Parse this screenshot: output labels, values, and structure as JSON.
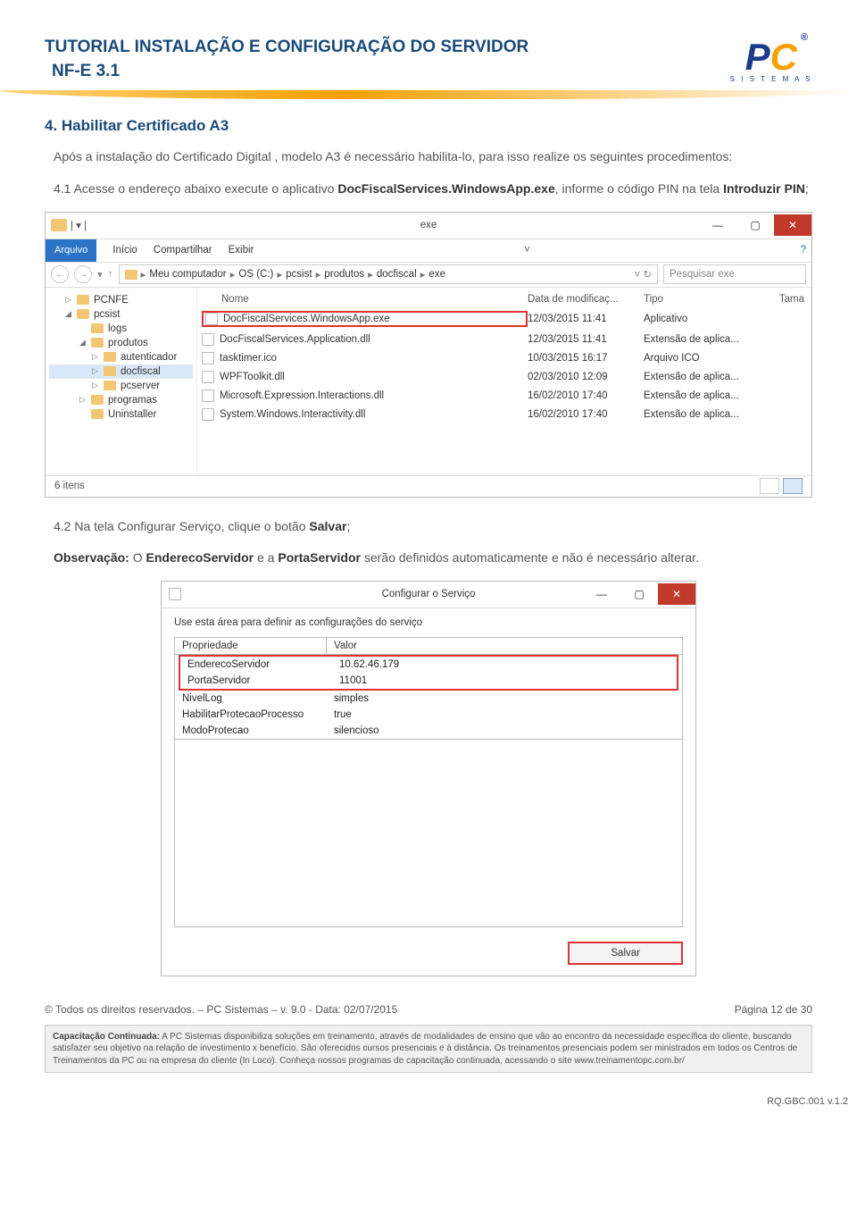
{
  "header": {
    "title_l1": "TUTORIAL INSTALAÇÃO E CONFIGURAÇÃO DO SERVIDOR",
    "title_l2": "NF-E 3.1",
    "logo_sub": "S I S T E M A S",
    "logo_r": "®",
    "logo_p": "P",
    "logo_c": "C"
  },
  "section": {
    "heading": "4. Habilitar Certificado A3",
    "intro": "Após a instalação do Certificado Digital , modelo A3 é necessário habilita-lo, para isso realize os seguintes procedimentos:",
    "step41_a": "4.1 Acesse o endereço abaixo  execute o aplicativo ",
    "step41_file": "DocFiscalServices.WindowsApp.exe",
    "step41_b": ", informe o código PIN na tela ",
    "step41_tela": "Introduzir PIN",
    "step41_c": ";",
    "step42_a": "4.2 Na tela Configurar Serviço, clique o botão ",
    "step42_btn": "Salvar",
    "step42_b": ";",
    "obs_a": "Observação:",
    "obs_b": " O ",
    "obs_c": "EnderecoServidor",
    "obs_d": " e a ",
    "obs_e": "PortaServidor",
    "obs_f": " serão definidos automaticamente e não é necessário alterar."
  },
  "explorer": {
    "title_center": "exe",
    "ribbon": {
      "arquivo": "Arquivo",
      "inicio": "Início",
      "compartilhar": "Compartilhar",
      "exibir": "Exibir",
      "help": "?"
    },
    "breadcrumb": [
      "Meu computador",
      "OS (C:)",
      "pcsist",
      "produtos",
      "docfiscal",
      "exe"
    ],
    "search_placeholder": "Pesquisar exe",
    "tree": [
      {
        "label": "PCNFE",
        "indent": 1,
        "exp": "▷"
      },
      {
        "label": "pcsist",
        "indent": 1,
        "exp": "◢"
      },
      {
        "label": "logs",
        "indent": 2,
        "exp": ""
      },
      {
        "label": "produtos",
        "indent": 2,
        "exp": "◢"
      },
      {
        "label": "autenticador",
        "indent": 3,
        "exp": "▷"
      },
      {
        "label": "docfiscal",
        "indent": 3,
        "exp": "▷",
        "sel": true
      },
      {
        "label": "pcserver",
        "indent": 3,
        "exp": "▷"
      },
      {
        "label": "programas",
        "indent": 2,
        "exp": "▷"
      },
      {
        "label": "Uninstaller",
        "indent": 2,
        "exp": ""
      }
    ],
    "cols": {
      "name": "Nome",
      "date": "Data de modificaç...",
      "type": "Tipo",
      "size": "Tama"
    },
    "rows": [
      {
        "name": "DocFiscalServices.WindowsApp.exe",
        "date": "12/03/2015 11:41",
        "type": "Aplicativo",
        "highlight": true
      },
      {
        "name": "DocFiscalServices.Application.dll",
        "date": "12/03/2015 11:41",
        "type": "Extensão de aplica..."
      },
      {
        "name": "tasktimer.ico",
        "date": "10/03/2015 16:17",
        "type": "Arquivo ICO"
      },
      {
        "name": "WPFToolkit.dll",
        "date": "02/03/2010 12:09",
        "type": "Extensão de aplica..."
      },
      {
        "name": "Microsoft.Expression.Interactions.dll",
        "date": "16/02/2010 17:40",
        "type": "Extensão de aplica..."
      },
      {
        "name": "System.Windows.Interactivity.dll",
        "date": "16/02/2010 17:40",
        "type": "Extensão de aplica..."
      }
    ],
    "status": "6 itens",
    "winbtns": {
      "min": "—",
      "max": "▢",
      "close": "✕"
    }
  },
  "cfg": {
    "title": "Configurar o Serviço",
    "desc": "Use esta área para definir as configurações do serviço",
    "head_prop": "Propriedade",
    "head_val": "Valor",
    "rows_hi": [
      {
        "p": "EnderecoServidor",
        "v": "10.62.46.179"
      },
      {
        "p": "PortaServidor",
        "v": "11001"
      }
    ],
    "rows": [
      {
        "p": "NivelLog",
        "v": "simples"
      },
      {
        "p": "HabilitarProtecaoProcesso",
        "v": "true"
      },
      {
        "p": "ModoProtecao",
        "v": "silencioso"
      }
    ],
    "salvar": "Salvar",
    "winbtns": {
      "min": "—",
      "max": "▢",
      "close": "✕"
    }
  },
  "footer": {
    "left": "© Todos os direitos reservados. – PC Sistemas – v. 9.0 - Data: 02/07/2015",
    "right": "Página 12 de 30",
    "capac_b": "Capacitação Continuada:",
    "capac": " A PC Sistemas disponibiliza soluções em treinamento, através de modalidades de ensino que vão ao encontro da necessidade específica do cliente, buscando satisfazer seu objetivo na relação de investimento x benefício. São oferecidos cursos presenciais e à distância. Os treinamentos presenciais podem ser ministrados em todos os Centros de Treinamentos da PC ou na empresa do cliente (In Loco). Conheça nossos programas de capacitação continuada, acessando o site www.treinamentopc.com.br/",
    "rq": "RQ.GBC.001 v.1.2"
  }
}
